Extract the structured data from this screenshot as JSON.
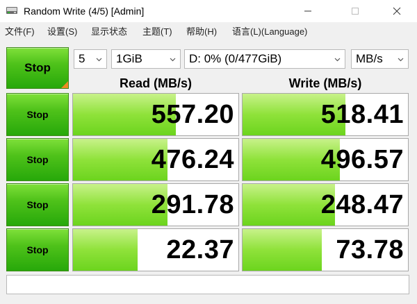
{
  "window": {
    "title": "Random Write (4/5) [Admin]"
  },
  "menu": [
    "文件(F)",
    "设置(S)",
    "显示状态",
    "主题(T)",
    "帮助(H)",
    "语言(L)(Language)"
  ],
  "controls": {
    "main_button_label": "Stop",
    "count": "5",
    "size": "1GiB",
    "drive": "D: 0% (0/477GiB)",
    "unit": "MB/s"
  },
  "headers": {
    "read": "Read (MB/s)",
    "write": "Write (MB/s)"
  },
  "rows": [
    {
      "button_label": "Stop",
      "read": "557.20",
      "write": "518.41",
      "read_fill": 0.62,
      "write_fill": 0.62
    },
    {
      "button_label": "Stop",
      "read": "476.24",
      "write": "496.57",
      "read_fill": 0.57,
      "write_fill": 0.59
    },
    {
      "button_label": "Stop",
      "read": "291.78",
      "write": "248.47",
      "read_fill": 0.57,
      "write_fill": 0.56
    },
    {
      "button_label": "Stop",
      "read": "22.37",
      "write": "73.78",
      "read_fill": 0.39,
      "write_fill": 0.48
    }
  ],
  "comment": "",
  "colors": {
    "button_green": "#4fc21a",
    "fill_green": "#8fe23a",
    "corner_orange": "#f08a24"
  },
  "icons": {
    "app": "disk-icon",
    "minimize": "minimize-icon",
    "maximize": "maximize-icon",
    "close": "close-icon"
  }
}
